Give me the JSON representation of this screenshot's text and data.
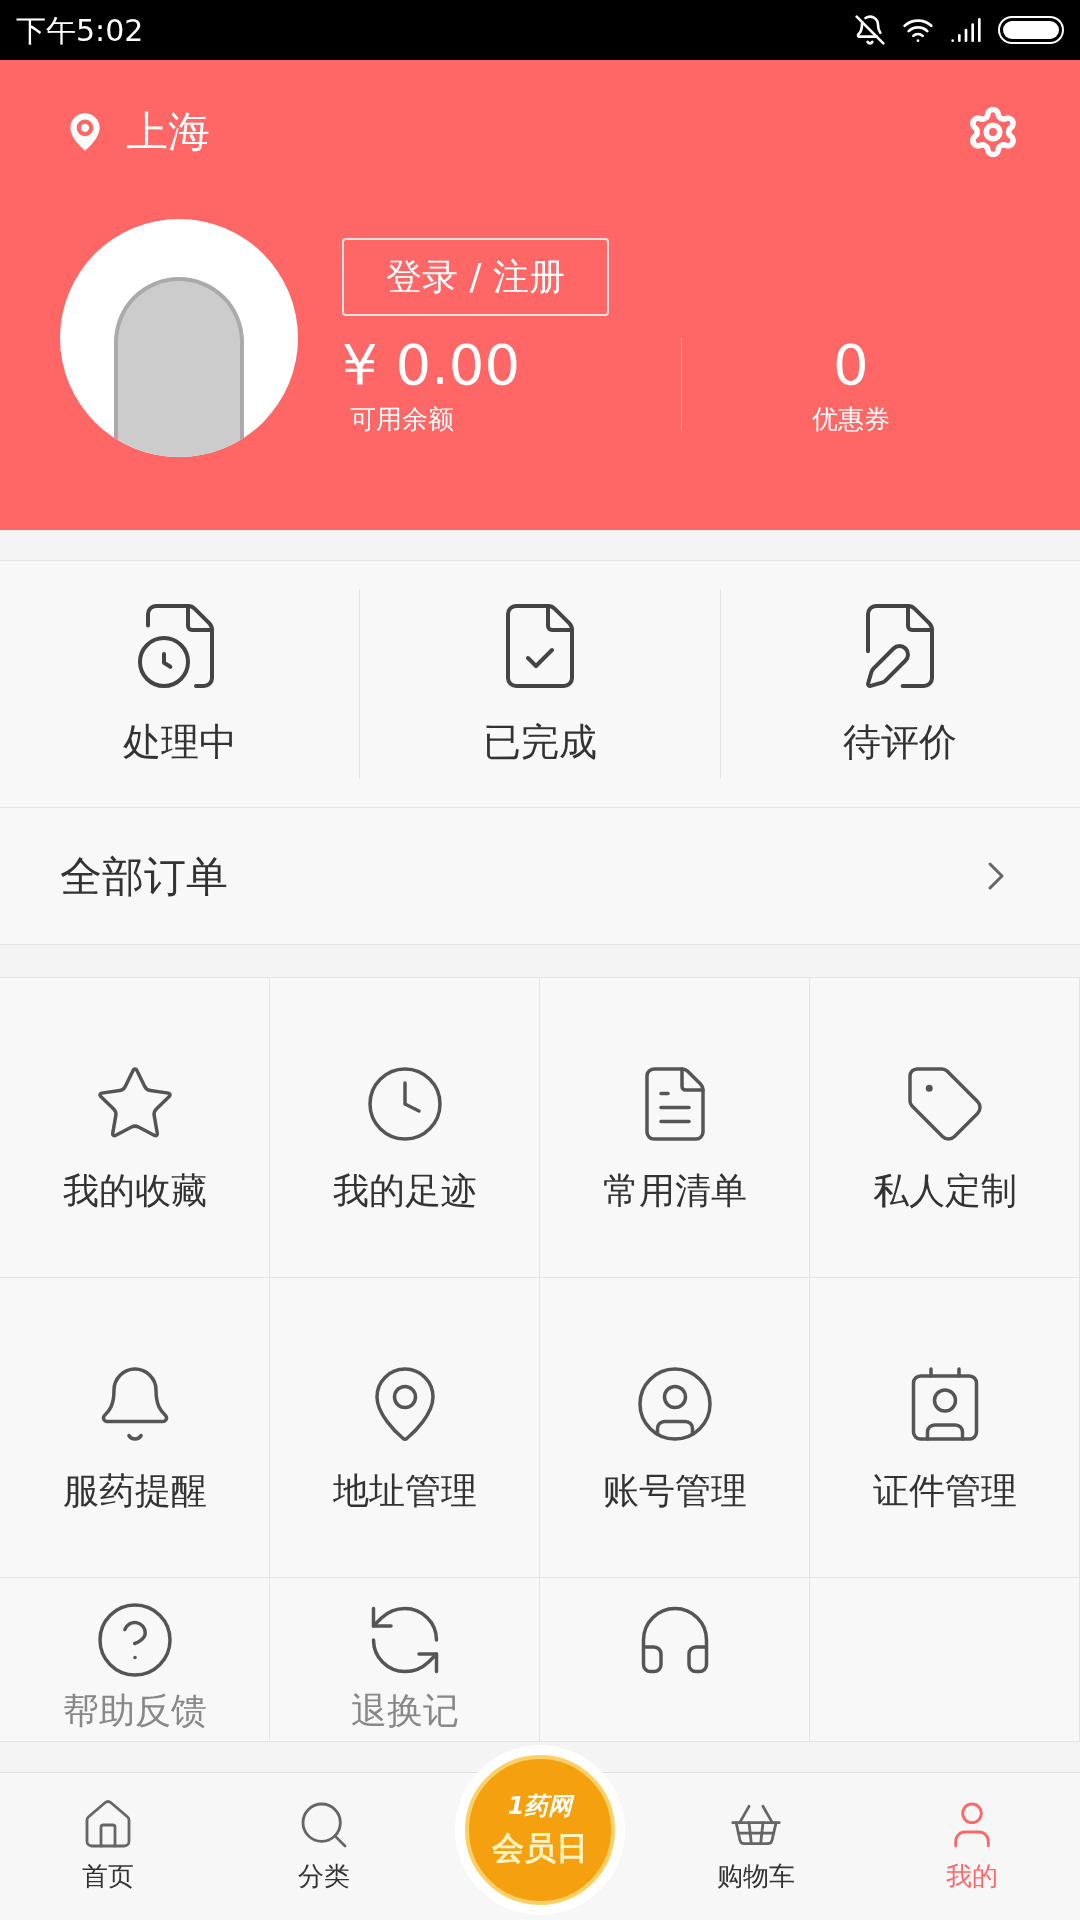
{
  "status_bar": {
    "time": "下午5:02"
  },
  "header": {
    "city": "上海",
    "login_button": "登录 / 注册",
    "balance": {
      "value": "¥ 0.00",
      "label": "可用余额"
    },
    "coupons": {
      "value": "0",
      "label": "优惠券"
    }
  },
  "order_statuses": [
    {
      "kind": "processing",
      "label": "处理中"
    },
    {
      "kind": "done",
      "label": "已完成"
    },
    {
      "kind": "review",
      "label": "待评价"
    }
  ],
  "all_orders": {
    "label": "全部订单"
  },
  "grid": [
    {
      "kind": "star",
      "label": "我的收藏"
    },
    {
      "kind": "clock",
      "label": "我的足迹"
    },
    {
      "kind": "list",
      "label": "常用清单"
    },
    {
      "kind": "tag",
      "label": "私人定制"
    },
    {
      "kind": "bell",
      "label": "服药提醒"
    },
    {
      "kind": "pin",
      "label": "地址管理"
    },
    {
      "kind": "user",
      "label": "账号管理"
    },
    {
      "kind": "card",
      "label": "证件管理"
    },
    {
      "kind": "help",
      "label": "帮助反馈"
    },
    {
      "kind": "swap",
      "label": "退换记"
    },
    {
      "kind": "headset"
    },
    {
      "kind": "empty"
    }
  ],
  "tabs": [
    {
      "kind": "home",
      "label": "首页",
      "selected": false
    },
    {
      "kind": "search",
      "label": "分类",
      "selected": false
    },
    {
      "kind": "promo",
      "line1": "1药网",
      "line2": "会员日"
    },
    {
      "kind": "cart",
      "label": "购物车",
      "selected": false
    },
    {
      "kind": "user",
      "label": "我的",
      "selected": true
    }
  ]
}
